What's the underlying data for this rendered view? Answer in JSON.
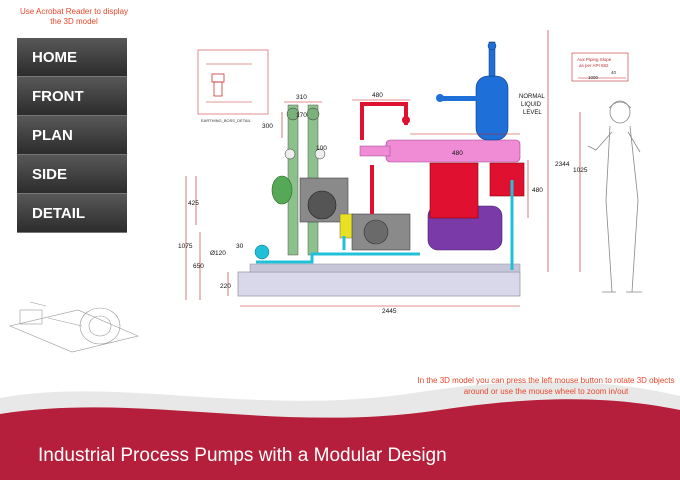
{
  "notice": "Use Acrobat Reader to display the 3D model",
  "nav": {
    "items": [
      "HOME",
      "FRONT",
      "PLAN",
      "SIDE",
      "DETAIL"
    ]
  },
  "drawing": {
    "detail_label": "EARTHING_BOSS_DETAIL",
    "dims": {
      "d310": "310",
      "d170": "170",
      "d480top": "480",
      "d300": "300",
      "d100": "100",
      "d480mid": "480",
      "d2344": "2344",
      "d480right": "480",
      "d425": "425",
      "d1075": "1075",
      "d650": "650",
      "d120": "Ø120",
      "d30": "30",
      "d220": "220",
      "d2445": "2445",
      "d1025": "1025"
    },
    "normal_liquid_level": [
      "NORMAL",
      "LIQUID",
      "LEVEL"
    ],
    "aux_piping_note": [
      "Aux Piping Slope",
      "as per API 682"
    ],
    "aux_dims": {
      "d40": "40",
      "d1000": "1000"
    }
  },
  "hint": "In the 3D model you can press the left mouse button to rotate 3D objects around or use the mouse wheel to zoom in/out",
  "banner_title": "Industrial Process Pumps with a Modular Design",
  "colors": {
    "accent_red": "#b51f3b",
    "nav_dark": "#3a3a3a",
    "hint_text": "#e8482b"
  }
}
